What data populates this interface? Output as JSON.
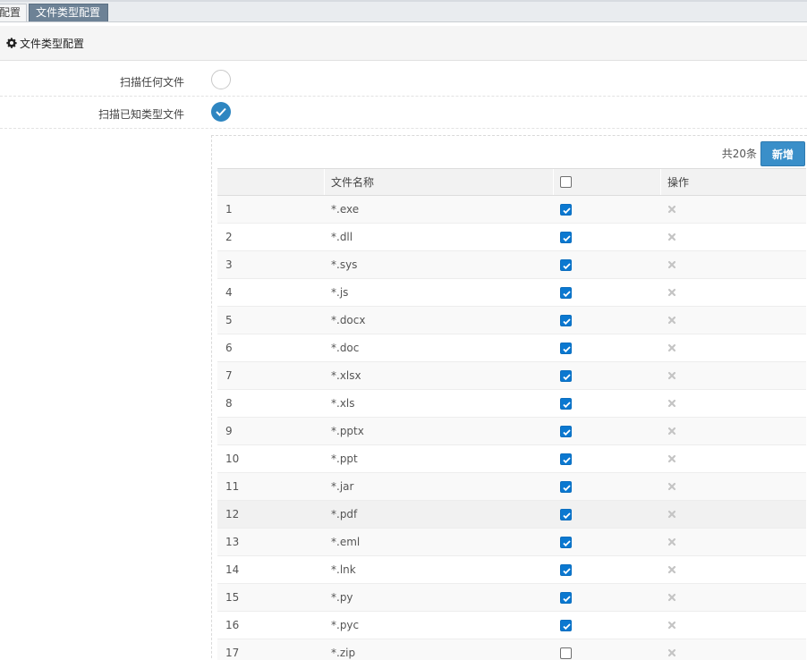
{
  "tabs": [
    {
      "label": "配置"
    },
    {
      "label": "文件类型配置"
    }
  ],
  "section": {
    "title": "文件类型配置",
    "icon": "gear-icon"
  },
  "options": [
    {
      "label": "扫描任何文件",
      "selected": false
    },
    {
      "label": "扫描已知类型文件",
      "selected": true
    }
  ],
  "toolbar": {
    "count_text": "共20条",
    "add_label": "新增"
  },
  "table": {
    "columns": [
      "",
      "文件名称",
      "",
      "操作"
    ],
    "header_checkbox_checked": false,
    "rows": [
      {
        "index": "1",
        "name": "*.exe",
        "checked": true
      },
      {
        "index": "2",
        "name": "*.dll",
        "checked": true
      },
      {
        "index": "3",
        "name": "*.sys",
        "checked": true
      },
      {
        "index": "4",
        "name": "*.js",
        "checked": true
      },
      {
        "index": "5",
        "name": "*.docx",
        "checked": true
      },
      {
        "index": "6",
        "name": "*.doc",
        "checked": true
      },
      {
        "index": "7",
        "name": "*.xlsx",
        "checked": true
      },
      {
        "index": "8",
        "name": "*.xls",
        "checked": true
      },
      {
        "index": "9",
        "name": "*.pptx",
        "checked": true
      },
      {
        "index": "10",
        "name": "*.ppt",
        "checked": true
      },
      {
        "index": "11",
        "name": "*.jar",
        "checked": true
      },
      {
        "index": "12",
        "name": "*.pdf",
        "checked": true
      },
      {
        "index": "13",
        "name": "*.eml",
        "checked": true
      },
      {
        "index": "14",
        "name": "*.lnk",
        "checked": true
      },
      {
        "index": "15",
        "name": "*.py",
        "checked": true
      },
      {
        "index": "16",
        "name": "*.pyc",
        "checked": true
      },
      {
        "index": "17",
        "name": "*.zip",
        "checked": false
      }
    ]
  },
  "colors": {
    "accent": "#3a8fc9",
    "checkbox": "#0b78d0",
    "active_tab": "#6d8296"
  }
}
